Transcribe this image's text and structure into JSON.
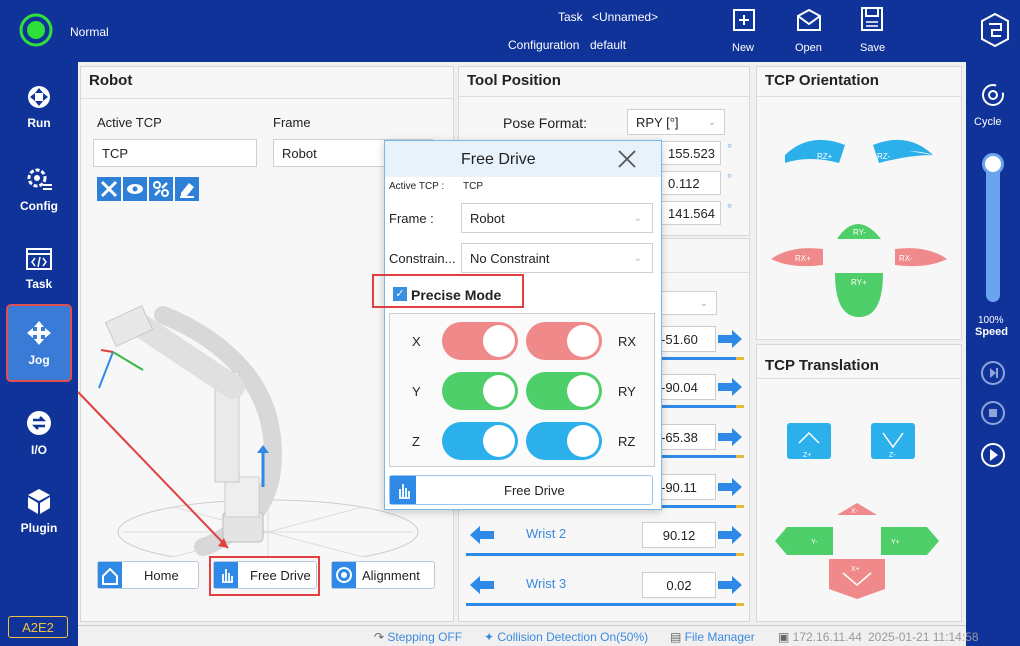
{
  "topbar": {
    "status": "Normal",
    "task_label": "Task",
    "task_value": "<Unnamed>",
    "config_label": "Configuration",
    "config_value": "default",
    "new_label": "New",
    "open_label": "Open",
    "save_label": "Save"
  },
  "sidebar": {
    "items": [
      {
        "label": "Run",
        "icon": "run-icon"
      },
      {
        "label": "Config",
        "icon": "gear-icon"
      },
      {
        "label": "Task",
        "icon": "code-icon"
      },
      {
        "label": "Jog",
        "icon": "move-icon"
      },
      {
        "label": "I/O",
        "icon": "io-icon"
      },
      {
        "label": "Plugin",
        "icon": "cube-icon"
      }
    ],
    "footer": "A2E2"
  },
  "rightbar": {
    "cycle_label": "Cycle",
    "speed_percent": "100%",
    "speed_label": "Speed",
    "speed_value": 1.0
  },
  "robot_panel": {
    "title": "Robot",
    "active_tcp_label": "Active TCP",
    "frame_label": "Frame",
    "active_tcp_value": "TCP",
    "frame_value": "Robot",
    "home_label": "Home",
    "free_drive_label": "Free Drive",
    "alignment_label": "Alignment"
  },
  "tool_position": {
    "title": "Tool Position",
    "pose_format_label": "Pose Format:",
    "pose_format_value": "RPY [°]",
    "values": [
      "155.523",
      "0.112",
      "141.564"
    ],
    "unit": "°"
  },
  "joints": [
    {
      "name": "",
      "value": "-51.60"
    },
    {
      "name": "",
      "value": "-90.04"
    },
    {
      "name": "",
      "value": "-65.38"
    },
    {
      "name": "",
      "value": "-90.11"
    },
    {
      "name": "Wrist 2",
      "value": "90.12"
    },
    {
      "name": "Wrist 3",
      "value": "0.02"
    }
  ],
  "tcp_orientation": {
    "title": "TCP Orientation",
    "buttons": [
      "RZ+",
      "RZ-",
      "RY-",
      "RX+",
      "RX-",
      "RY+"
    ]
  },
  "tcp_translation": {
    "title": "TCP Translation",
    "buttons": [
      "Z+",
      "Z-",
      "X-",
      "Y-",
      "Y+",
      "X+"
    ]
  },
  "free_drive_dialog": {
    "title": "Free Drive",
    "active_tcp_label": "Active TCP :",
    "active_tcp_value": "TCP",
    "frame_label": "Frame :",
    "frame_value": "Robot",
    "constraint_label": "Constrain...",
    "constraint_value": "No Constraint",
    "precise_mode_label": "Precise Mode",
    "precise_mode_checked": true,
    "axes_left": [
      "X",
      "Y",
      "Z"
    ],
    "axes_right": [
      "RX",
      "RY",
      "RZ"
    ],
    "button_label": "Free Drive"
  },
  "statusbar": {
    "stepping": "Stepping OFF",
    "collision": "Collision Detection On(50%)",
    "file_manager": "File Manager",
    "ip": "172.16.11.44",
    "datetime": "2025-01-21 11:14:58"
  },
  "colors": {
    "nav": "#10339a",
    "accent": "#2e8ae6",
    "red": "#f08a8a",
    "green": "#4fcf6a",
    "blue": "#2cb0ec"
  }
}
